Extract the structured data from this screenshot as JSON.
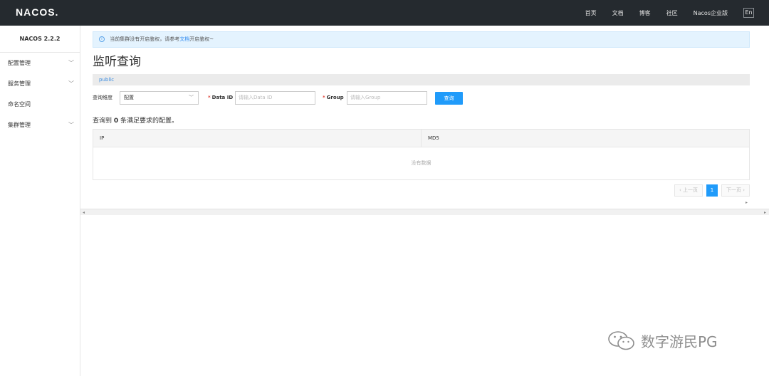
{
  "topbar": {
    "logo": "NACOS.",
    "nav": [
      "首页",
      "文档",
      "博客",
      "社区",
      "Nacos企业版"
    ],
    "lang": "En"
  },
  "sidebar": {
    "version": "NACOS 2.2.2",
    "items": [
      {
        "label": "配置管理",
        "expandable": true
      },
      {
        "label": "服务管理",
        "expandable": true
      },
      {
        "label": "命名空间",
        "expandable": false
      },
      {
        "label": "集群管理",
        "expandable": true
      }
    ]
  },
  "notice": {
    "prefix": "当前集群没有开启鉴权，请参考",
    "link": "文档",
    "suffix": "开启鉴权~"
  },
  "page": {
    "title": "监听查询",
    "namespace": "public"
  },
  "form": {
    "dimension_label": "查询维度",
    "dimension_value": "配置",
    "dataid_label": "Data ID",
    "dataid_placeholder": "请输入Data ID",
    "group_label": "Group",
    "group_placeholder": "请输入Group",
    "query_button": "查询",
    "required_mark": "*"
  },
  "result": {
    "prefix": "查询到",
    "count": "0",
    "suffix": "条满足要求的配置。"
  },
  "table": {
    "columns": [
      "IP",
      "MD5"
    ],
    "empty_text": "没有数据"
  },
  "pagination": {
    "prev": "‹ 上一页",
    "current": "1",
    "next": "下一页 ›"
  },
  "watermark": {
    "text": "数字游民PG"
  },
  "colors": {
    "topbar": "#252a2f",
    "accent": "#209bfa",
    "notice_bg": "#e4f3fe"
  }
}
